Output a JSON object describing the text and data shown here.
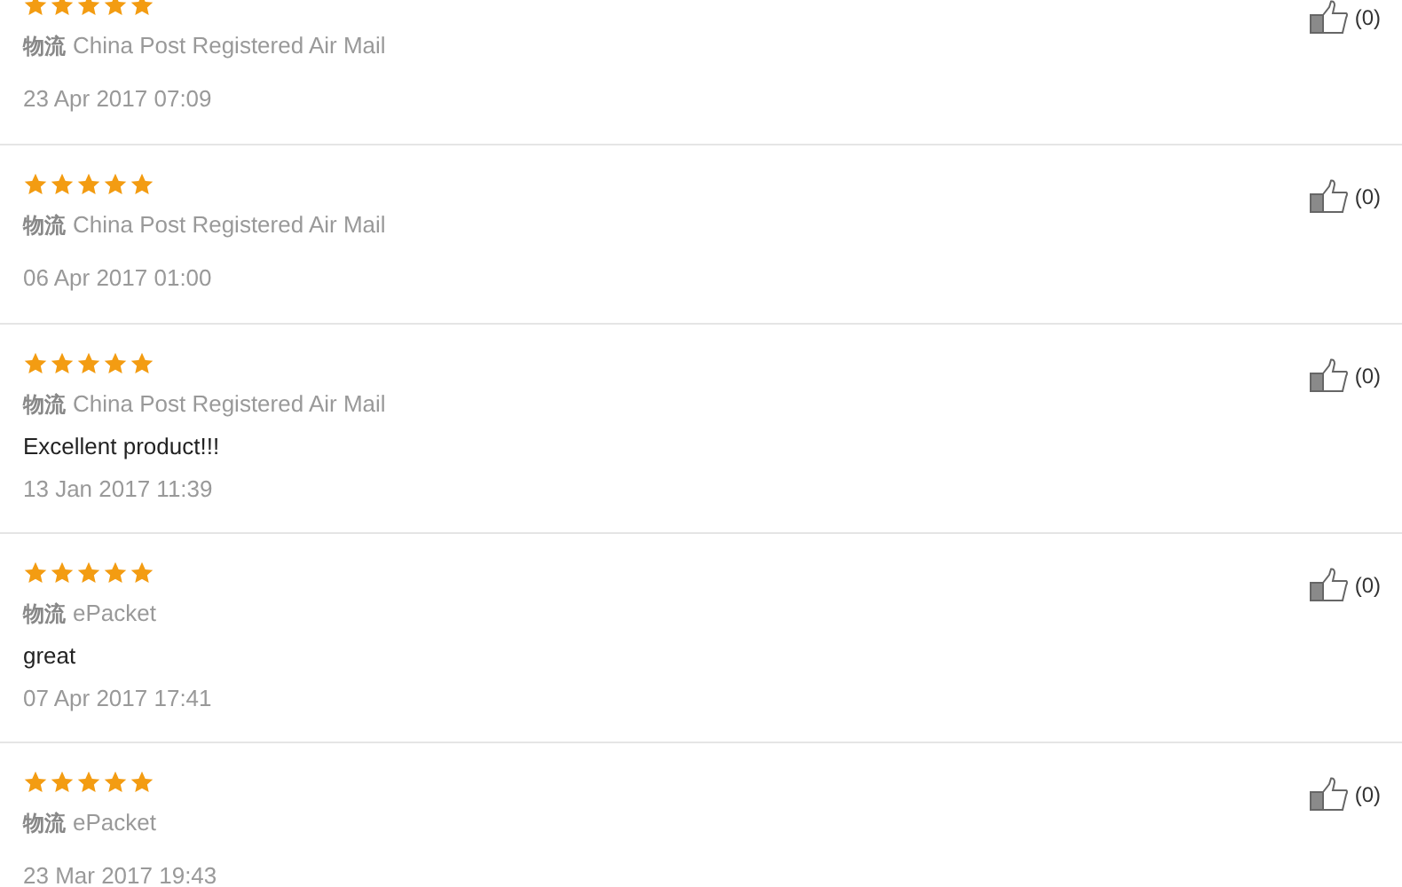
{
  "reviews": [
    {
      "stars": 5,
      "shipping_label": "物流",
      "shipping": "China Post Registered Air Mail",
      "date": "23 Apr 2017 07:09",
      "likes": "(0)"
    },
    {
      "stars": 5,
      "shipping_label": "物流",
      "shipping": "China Post Registered Air Mail",
      "date": "06 Apr 2017 01:00",
      "likes": "(0)"
    },
    {
      "stars": 5,
      "shipping_label": "物流",
      "shipping": "China Post Registered Air Mail",
      "comment": "Excellent product!!!",
      "date": "13 Jan 2017 11:39",
      "likes": "(0)"
    },
    {
      "stars": 5,
      "shipping_label": "物流",
      "shipping": "ePacket",
      "comment": "great",
      "date": "07 Apr 2017 17:41",
      "likes": "(0)"
    },
    {
      "stars": 5,
      "shipping_label": "物流",
      "shipping": "ePacket",
      "date": "23 Mar 2017 19:43",
      "likes": "(0)"
    }
  ]
}
